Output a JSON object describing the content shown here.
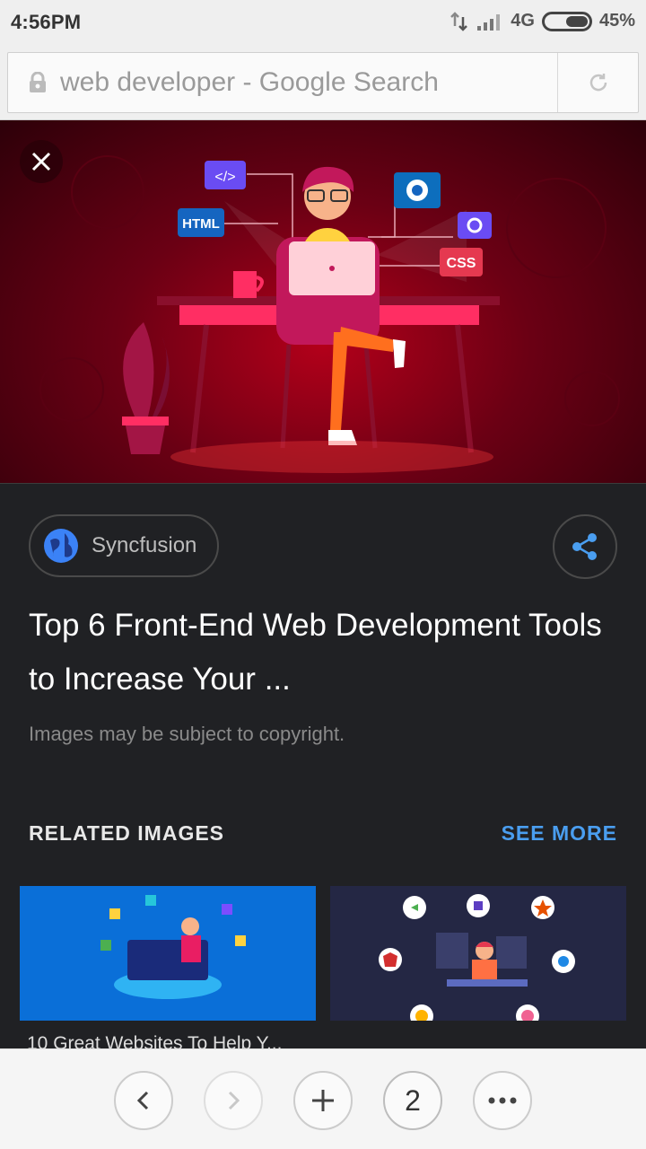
{
  "status_bar": {
    "time": "4:56PM",
    "network": "4G",
    "battery": "45%",
    "battery_level": 0.45
  },
  "address_bar": {
    "text": "web developer - Google Search",
    "lock_icon": "lock-icon",
    "reload_icon": "reload-icon"
  },
  "hero_image": {
    "labels": {
      "code": "</>",
      "html": "HTML",
      "css": "CSS"
    }
  },
  "result": {
    "source": "Syncfusion",
    "title": "Top 6 Front-End Web Development Tools to Increase Your ...",
    "copyright_note": "Images may be subject to copyright."
  },
  "related": {
    "label": "RELATED IMAGES",
    "see_more": "SEE MORE",
    "items": [
      {
        "caption": "10 Great Websites To Help Y..."
      },
      {
        "caption": ""
      }
    ]
  },
  "bottom_nav": {
    "tab_count": "2"
  },
  "colors": {
    "accent": "#4a9ef0",
    "panel_bg": "#202124",
    "hero_red": "#b3001a"
  }
}
